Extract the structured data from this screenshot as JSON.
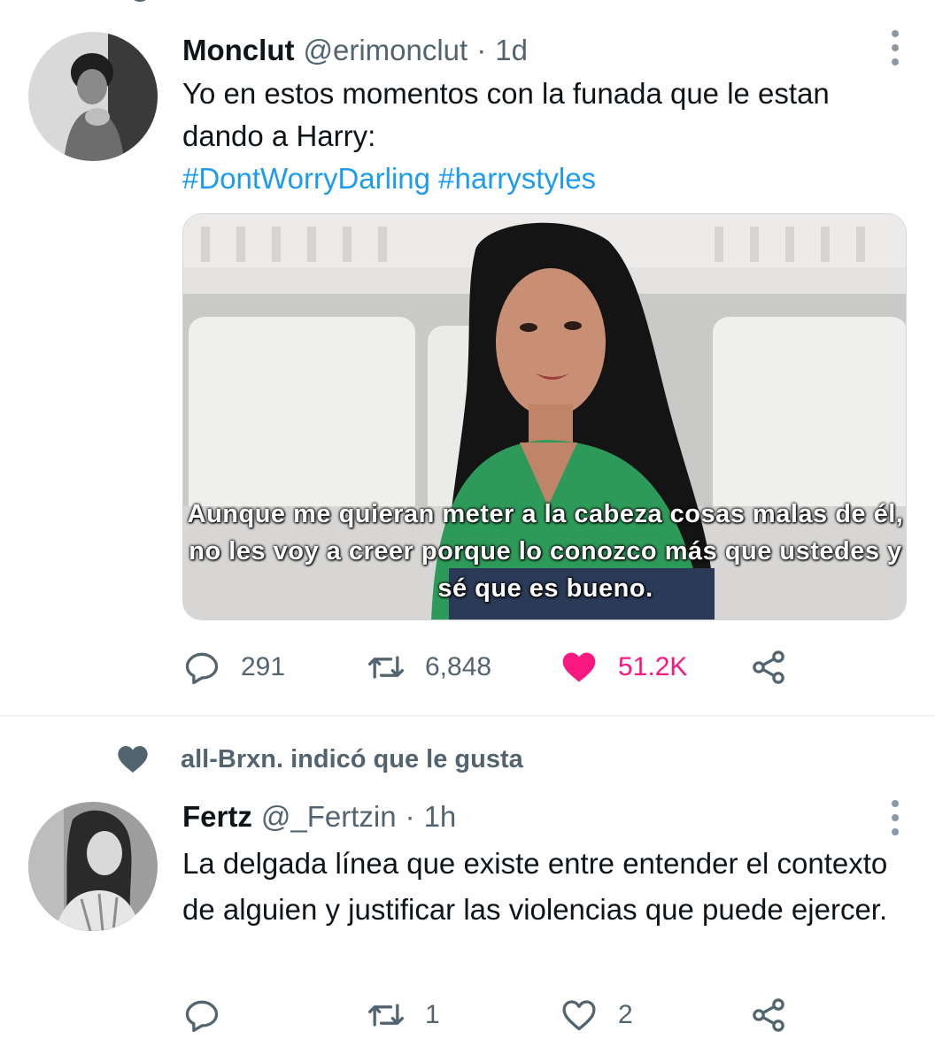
{
  "colors": {
    "accent": "#1d9bf0",
    "like": "#f91880",
    "muted": "#536471"
  },
  "tweet1": {
    "name": "Monclut",
    "handle": "@erimonclut",
    "separator": "·",
    "time": "1d",
    "text": "Yo en estos momentos con la funada que le estan dando a Harry:",
    "hashtags": "#DontWorryDarling #harrystyles",
    "media_caption": "Aunque me quieran meter a la cabeza cosas malas de él, no les voy a creer porque lo conozco más que ustedes y sé que es bueno.",
    "replies": "291",
    "retweets": "6,848",
    "likes": "51.2K",
    "liked": true
  },
  "social_context": {
    "icon": "heart-icon",
    "text": "all-Brxn. indicó que le gusta"
  },
  "tweet2": {
    "name": "Fertz",
    "handle": "@_Fertzin",
    "separator": "·",
    "time": "1h",
    "text": "La delgada línea que existe entre entender el contexto de alguien y justificar las violencias que puede ejercer.",
    "replies": "",
    "retweets": "1",
    "likes": "2",
    "liked": false
  }
}
